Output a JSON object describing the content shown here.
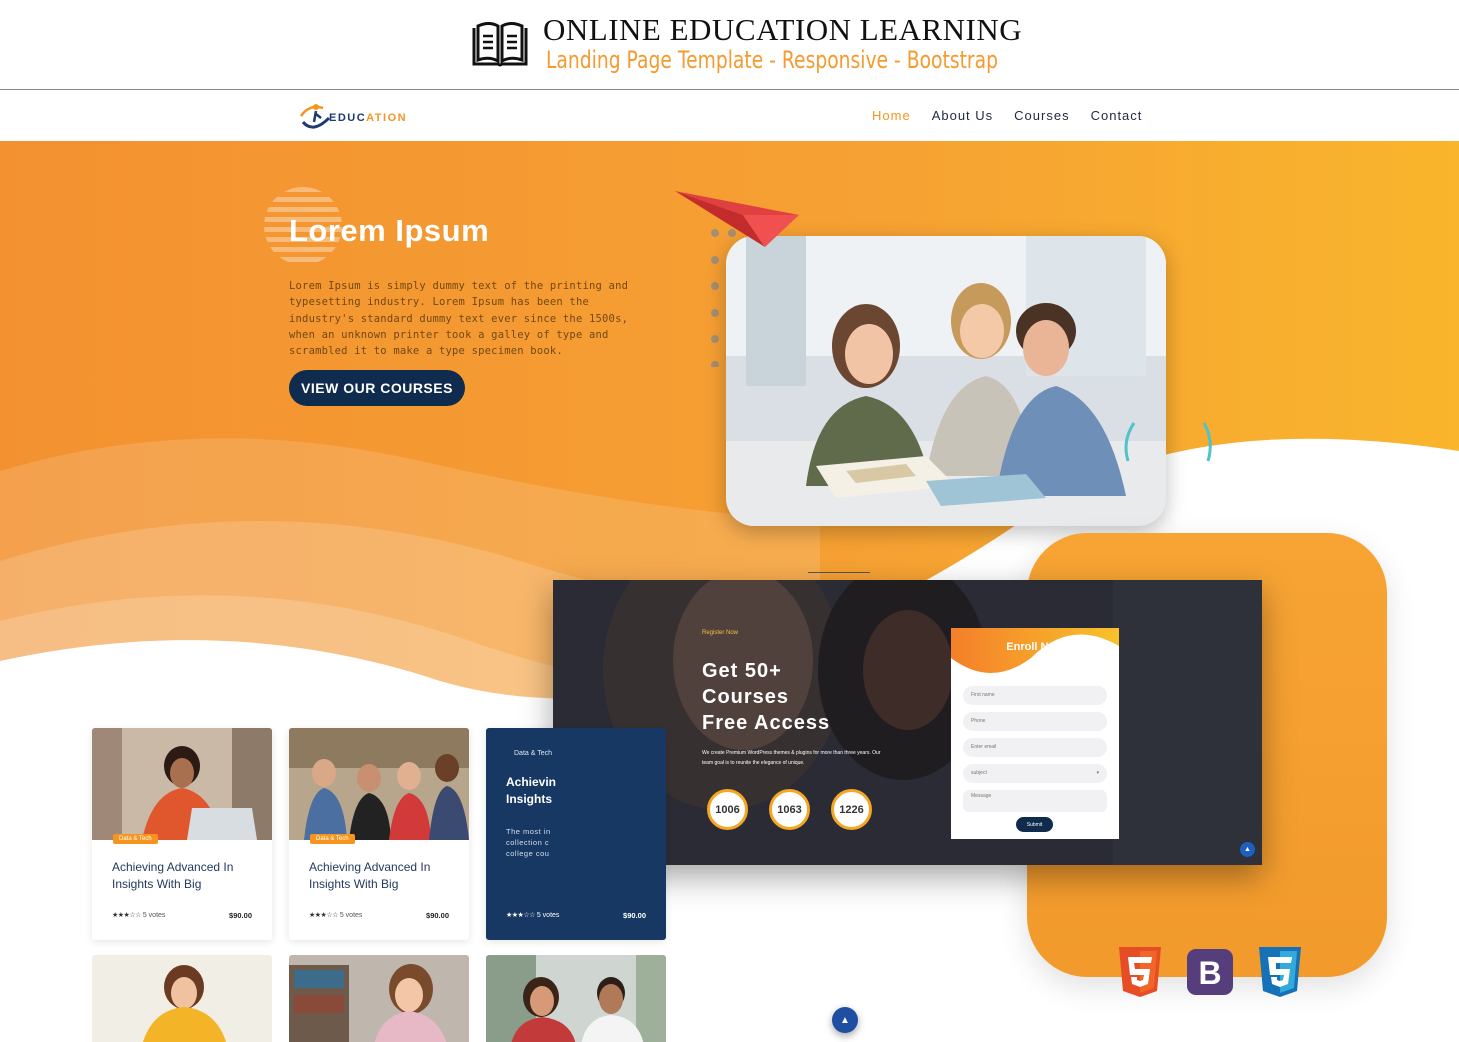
{
  "banner": {
    "title": "ONLINE EDUCATION LEARNING",
    "subtitle": "Landing Page Template - Responsive - Bootstrap",
    "icon": "open-book-icon"
  },
  "nav": {
    "logo_text_a": "EDUC",
    "logo_text_b": "ATION",
    "items": [
      {
        "label": "Home",
        "active": true
      },
      {
        "label": "About Us",
        "active": false
      },
      {
        "label": "Courses",
        "active": false
      },
      {
        "label": "Contact",
        "active": false
      }
    ]
  },
  "hero": {
    "title": "Lorem Ipsum",
    "text": "Lorem Ipsum is simply dummy text of the printing and typesetting industry. Lorem Ipsum has been the industry's standard dummy text ever since the 1500s, when an unknown printer took a galley of type and scrambled it to make a type specimen book.",
    "button": "VIEW OUR COURSES"
  },
  "preview": {
    "small_label": "Register Now",
    "title_lines": [
      "Get 50+",
      "Courses",
      "Free Access"
    ],
    "desc": "We create Premium WordPress themes & plugins for more than three years. Our team goal is to reunite the elegance of unique.",
    "counters": [
      "1006",
      "1063",
      "1226"
    ],
    "form": {
      "title": "Enroll Now",
      "fields": [
        "First name",
        "Phone",
        "Enter email",
        "subject",
        "Message"
      ],
      "submit": "Submit"
    }
  },
  "cards": [
    {
      "badge": "Data & Tech",
      "title": "Achieving Advanced In Insights With Big",
      "stars": "★★★☆☆",
      "votes": "5 votes",
      "price": "$90.00"
    },
    {
      "badge": "Data & Tech",
      "title": "Achieving Advanced In Insights With Big",
      "stars": "★★★☆☆",
      "votes": "5 votes",
      "price": "$90.00"
    },
    {
      "badge": "Data & Tech",
      "title": "Achievin Insights",
      "text": "The most in collection c college cou",
      "stars": "★★★☆☆",
      "votes": "5 votes",
      "price": "$90.00"
    }
  ],
  "tech_icons": [
    "html5-icon",
    "bootstrap-icon",
    "css3-icon"
  ],
  "colors": {
    "orange": "#f5951f",
    "navy": "#0f2b4d",
    "blue": "#1f4fa3"
  }
}
